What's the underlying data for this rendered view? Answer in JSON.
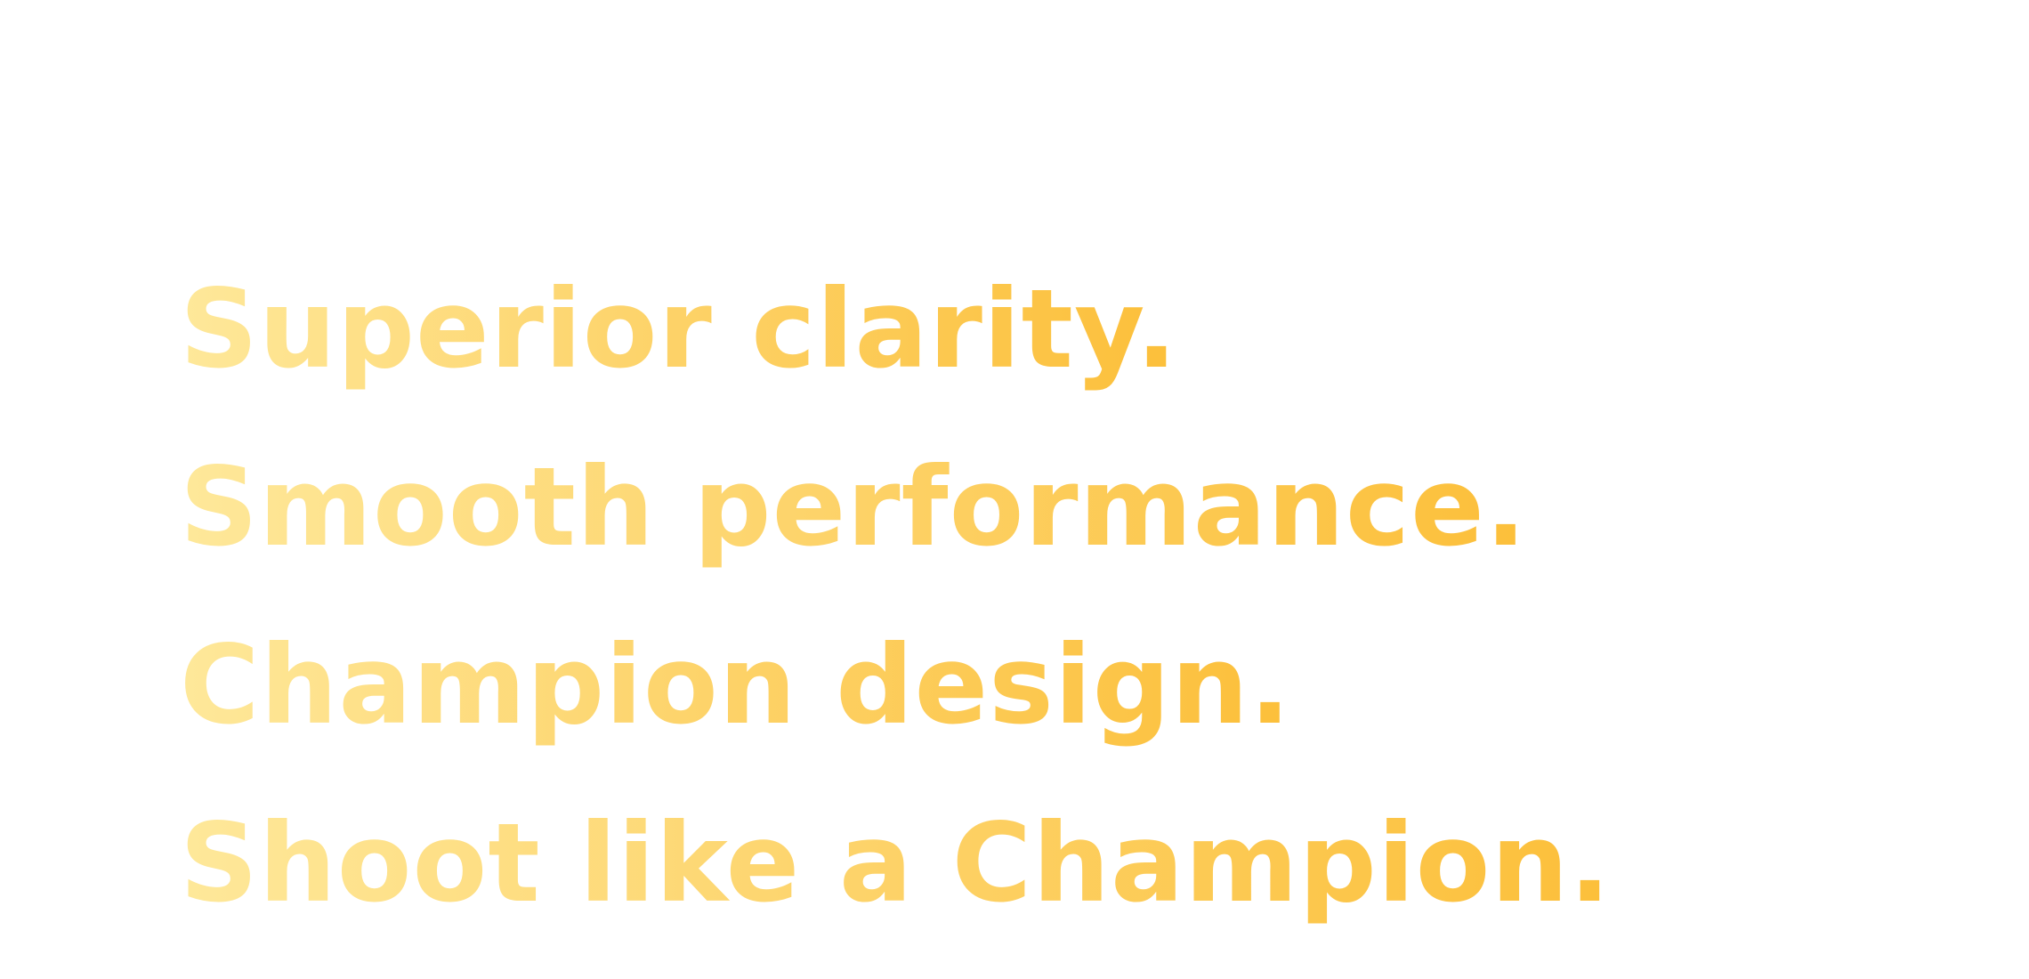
{
  "colors": {
    "gradient_start": "#fee89a",
    "gradient_mid": "#fdd46c",
    "gradient_end": "#fcbf3a",
    "background": "#ffffff"
  },
  "headlines": [
    "Superior clarity.",
    "Smooth performance.",
    "Champion design.",
    "Shoot like a Champion."
  ]
}
